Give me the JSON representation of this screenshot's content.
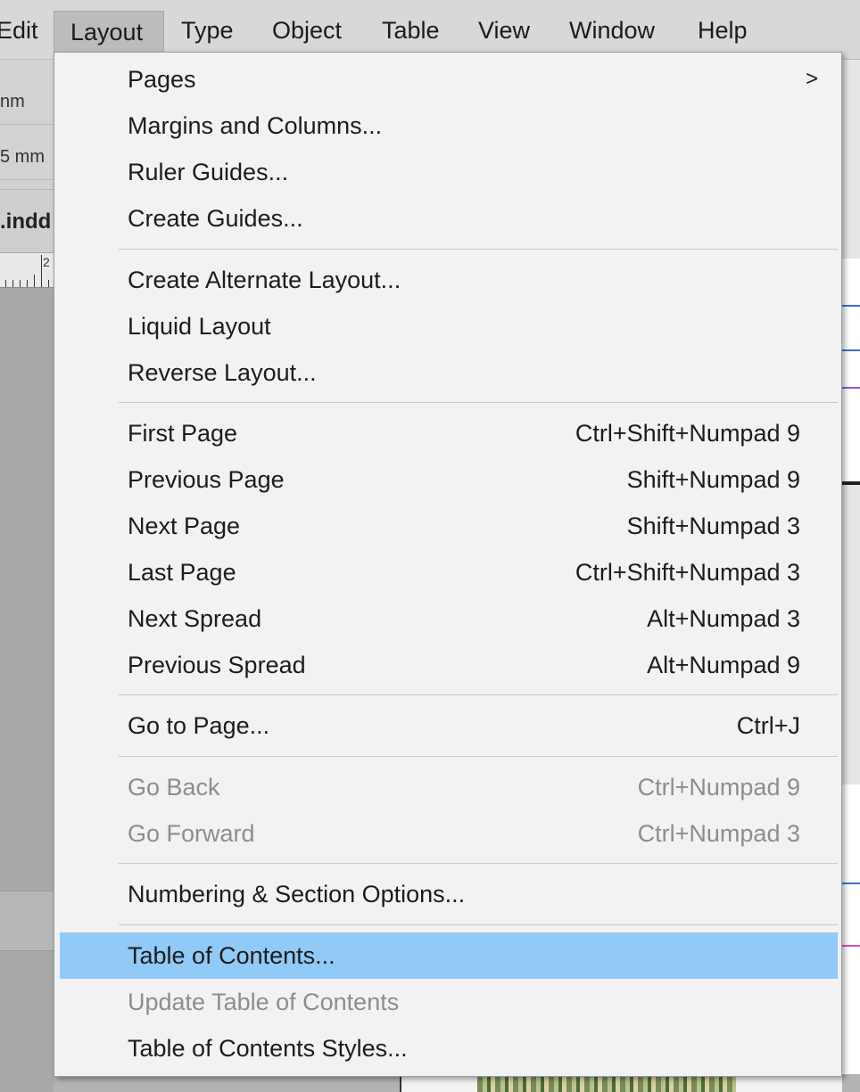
{
  "menubar": {
    "items": [
      {
        "label": "Edit"
      },
      {
        "label": "Layout"
      },
      {
        "label": "Type"
      },
      {
        "label": "Object"
      },
      {
        "label": "Table"
      },
      {
        "label": "View"
      },
      {
        "label": "Window"
      },
      {
        "label": "Help"
      }
    ]
  },
  "toolbar": {
    "row1_value": "nm",
    "row2_value": "5 mm"
  },
  "document": {
    "tab_label": ".indd",
    "ruler_number": "2"
  },
  "layout_menu": {
    "items": [
      {
        "label": "Pages",
        "shortcut": "",
        "submenu_arrow": ">"
      },
      {
        "label": "Margins and Columns...",
        "shortcut": ""
      },
      {
        "label": "Ruler Guides...",
        "shortcut": ""
      },
      {
        "label": "Create Guides...",
        "shortcut": ""
      },
      {
        "label": "Create Alternate Layout...",
        "shortcut": ""
      },
      {
        "label": "Liquid Layout",
        "shortcut": ""
      },
      {
        "label": "Reverse Layout...",
        "shortcut": ""
      },
      {
        "label": "First Page",
        "shortcut": "Ctrl+Shift+Numpad 9"
      },
      {
        "label": "Previous Page",
        "shortcut": "Shift+Numpad 9"
      },
      {
        "label": "Next Page",
        "shortcut": "Shift+Numpad 3"
      },
      {
        "label": "Last Page",
        "shortcut": "Ctrl+Shift+Numpad 3"
      },
      {
        "label": "Next Spread",
        "shortcut": "Alt+Numpad 3"
      },
      {
        "label": "Previous Spread",
        "shortcut": "Alt+Numpad 9"
      },
      {
        "label": "Go to Page...",
        "shortcut": "Ctrl+J"
      },
      {
        "label": "Go Back",
        "shortcut": "Ctrl+Numpad 9",
        "state": "disabled"
      },
      {
        "label": "Go Forward",
        "shortcut": "Ctrl+Numpad 3",
        "state": "disabled"
      },
      {
        "label": "Numbering & Section Options...",
        "shortcut": ""
      },
      {
        "label": "Table of Contents...",
        "shortcut": "",
        "state": "highlighted"
      },
      {
        "label": "Update Table of Contents",
        "shortcut": "",
        "state": "disabled"
      },
      {
        "label": "Table of Contents Styles...",
        "shortcut": ""
      }
    ]
  },
  "colors": {
    "menu_highlight": "#91c9f7",
    "menu_background": "#f2f2f2",
    "disabled_text": "#8d8d8d",
    "menubar_background": "#d8d8d8"
  }
}
